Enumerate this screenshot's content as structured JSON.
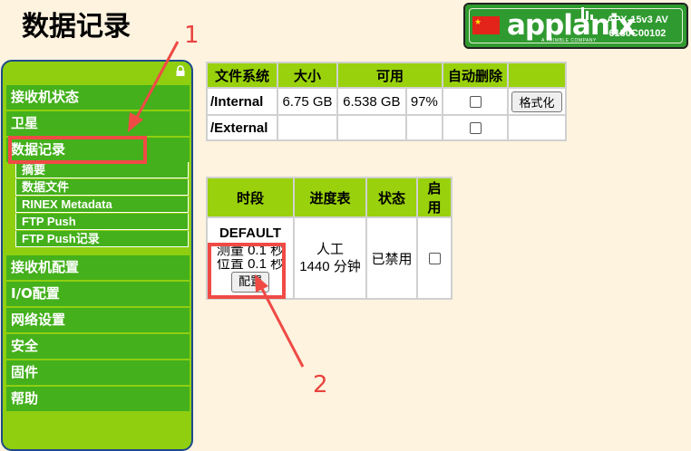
{
  "page_title": "数据记录",
  "brand": {
    "name": "applanix",
    "subtitle": "A TRIMBLE COMPANY",
    "model": "APX-15v3 AV",
    "serial": "6130C00102",
    "flag_color": "#e2241a",
    "box_color": "#2f9a2f"
  },
  "sidebar": {
    "items": [
      {
        "label": "接收机状态"
      },
      {
        "label": "卫星"
      },
      {
        "label": "数据记录"
      },
      {
        "label": "接收机配置"
      },
      {
        "label": "I/O配置"
      },
      {
        "label": "网络设置"
      },
      {
        "label": "安全"
      },
      {
        "label": "固件"
      },
      {
        "label": "帮助"
      }
    ],
    "sub_items": [
      {
        "label": "摘要"
      },
      {
        "label": "数据文件"
      },
      {
        "label": "RINEX Metadata"
      },
      {
        "label": "FTP Push"
      },
      {
        "label": "FTP Push记录"
      }
    ]
  },
  "fs_table": {
    "headers": [
      "文件系统",
      "大小",
      "可用",
      "自动删除"
    ],
    "rows": [
      {
        "name": "/Internal",
        "size": "6.75 GB",
        "avail": "6.538 GB",
        "pct": "97%",
        "auto_delete": false,
        "button": "格式化"
      },
      {
        "name": "/External",
        "size": "",
        "avail": "",
        "pct": "",
        "auto_delete": false,
        "button": ""
      }
    ]
  },
  "session_table": {
    "headers": [
      "时段",
      "进度表",
      "状态",
      "启用"
    ],
    "row": {
      "name": "DEFAULT",
      "measure": "测量 0.1 秒",
      "position": "位置 0.1 秒",
      "config_button": "配置",
      "schedule_1": "人工",
      "schedule_2": "1440 分钟",
      "status": "已禁用",
      "enabled": false
    }
  },
  "annotations": {
    "label_1": "1",
    "label_2": "2",
    "color": "#f04a45"
  }
}
